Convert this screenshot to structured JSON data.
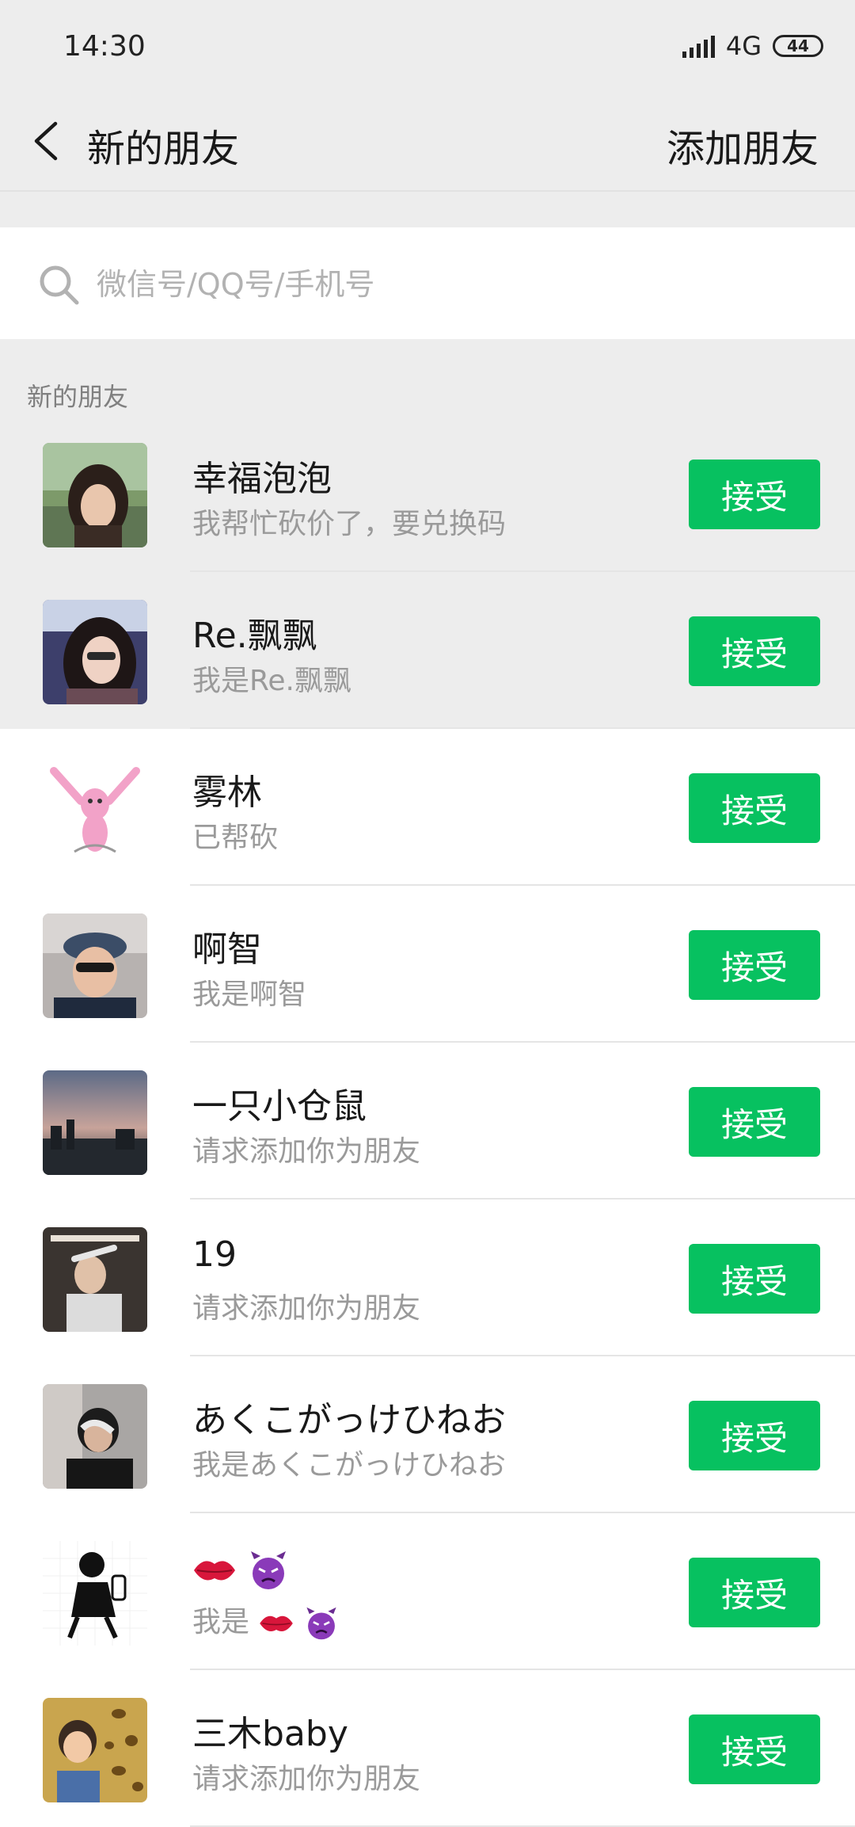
{
  "status_bar": {
    "time": "14:30",
    "network": "4G",
    "battery": "44"
  },
  "header": {
    "title": "新的朋友",
    "action": "添加朋友",
    "back_icon": "chevron-left-icon"
  },
  "search": {
    "placeholder": "微信号/QQ号/手机号",
    "value": "",
    "icon": "search-icon"
  },
  "section": {
    "label": "新的朋友"
  },
  "colors": {
    "accent": "#07c160",
    "background": "#ededed",
    "row_bg": "#ffffff",
    "secondary_text": "#9a9a9a"
  },
  "requests": [
    {
      "name": "幸福泡泡",
      "message": "我帮忙砍价了，要兑换码",
      "action": "接受"
    },
    {
      "name": "Re.飘飘",
      "message": "我是Re.飘飘",
      "action": "接受"
    },
    {
      "name": "雾林",
      "message": "已帮砍",
      "action": "接受"
    },
    {
      "name": "啊智",
      "message": "我是啊智",
      "action": "接受"
    },
    {
      "name": "一只小仓鼠",
      "message": "请求添加你为朋友",
      "action": "接受"
    },
    {
      "name": "19",
      "message": "请求添加你为朋友",
      "action": "接受"
    },
    {
      "name": "あくこがっけひねお",
      "message": "我是あくこがっけひねお",
      "action": "接受"
    },
    {
      "name": "",
      "message": "我是",
      "action": "接受",
      "name_emoji": [
        "kiss-mark-emoji",
        "angry-devil-emoji"
      ],
      "message_emoji": [
        "kiss-mark-emoji",
        "angry-devil-emoji"
      ]
    },
    {
      "name": "三木baby",
      "message": "请求添加你为朋友",
      "action": "接受"
    }
  ]
}
